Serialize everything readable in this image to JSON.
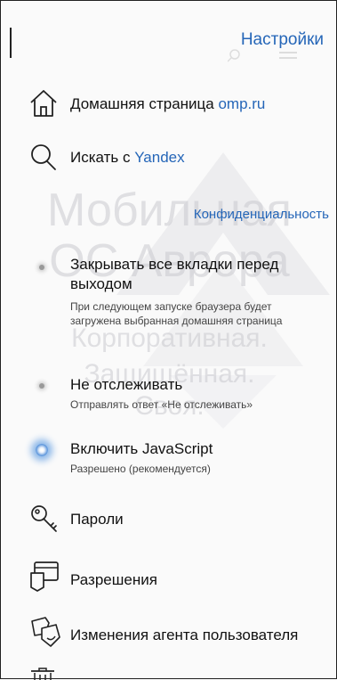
{
  "header": {
    "title": "Настройки"
  },
  "watermark": {
    "line1": "Мобильная",
    "line2": "ОС Аврора",
    "line3": "Корпоративная.",
    "line4": "Защищённая.",
    "line5": "Своя."
  },
  "homepage": {
    "label": "Домашняя страница",
    "value": "omp.ru",
    "icon": "home-icon"
  },
  "search": {
    "label": "Искать с",
    "value": "Yandex",
    "icon": "search-icon"
  },
  "privacy": {
    "section_title": "Конфиденциальность",
    "close_tabs": {
      "title": "Закрывать все вкладки перед выходом",
      "description": "При следующем запуске браузера будет загружена выбранная домашняя страница",
      "enabled": false
    },
    "do_not_track": {
      "title": "Не отслеживать",
      "description": "Отправлять ответ «Не отслеживать»",
      "enabled": false
    },
    "javascript": {
      "title": "Включить JavaScript",
      "description": "Разрешено (рекомендуется)",
      "enabled": true
    }
  },
  "menu": {
    "passwords": {
      "label": "Пароли",
      "icon": "key-icon"
    },
    "permissions": {
      "label": "Разрешения",
      "icon": "permissions-icon"
    },
    "user_agent": {
      "label": "Изменения агента пользователя",
      "icon": "mask-icon"
    },
    "clear_data": {
      "icon": "trash-icon"
    }
  },
  "colors": {
    "accent": "#2566b8",
    "text": "#111111",
    "background": "#fafafa"
  }
}
